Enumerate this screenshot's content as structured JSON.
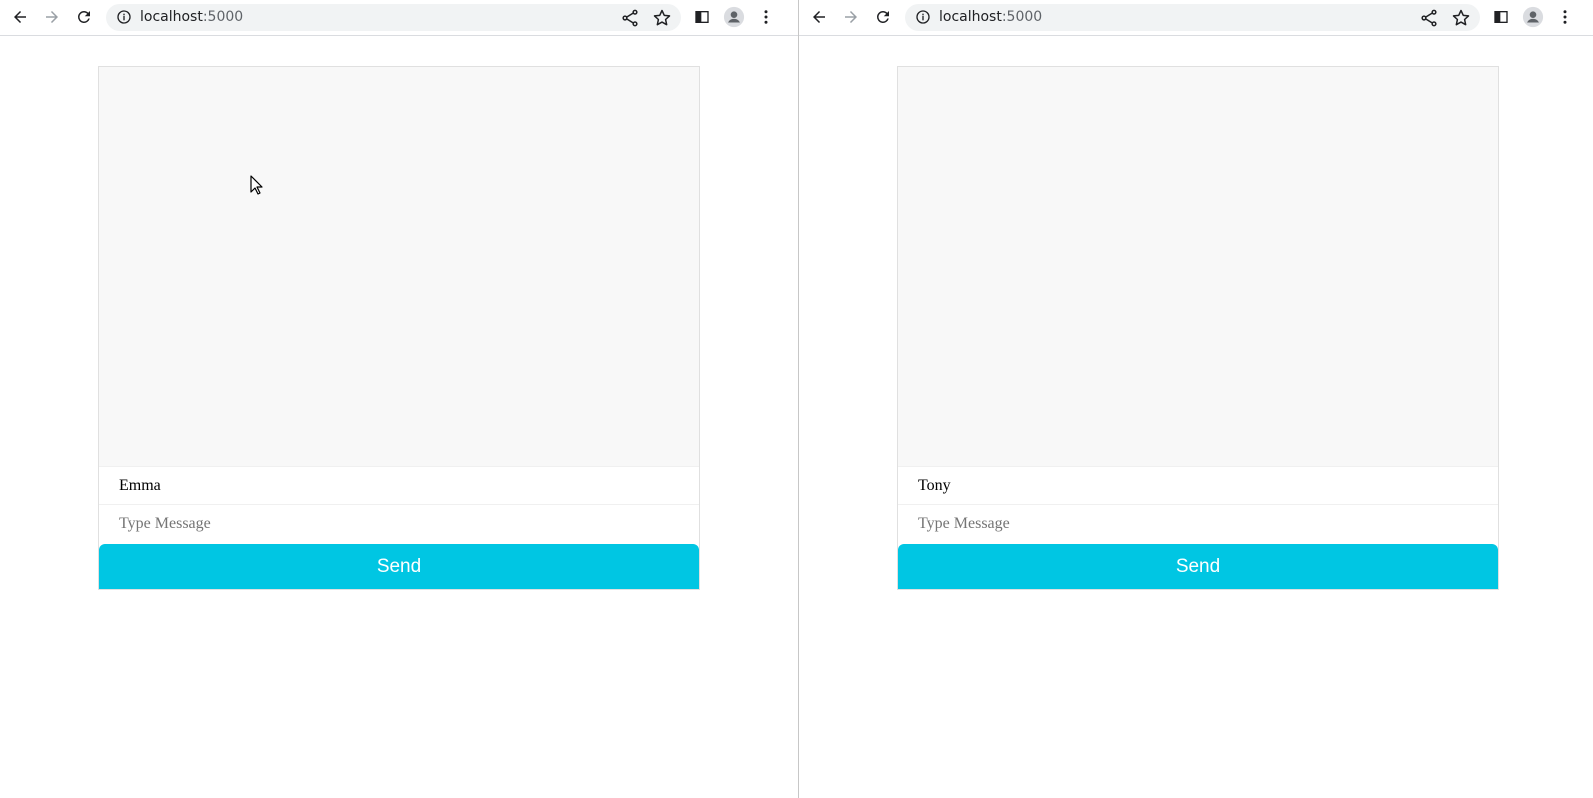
{
  "windows": [
    {
      "url_host": "localhost",
      "url_port": ":5000",
      "chat": {
        "name_value": "Emma",
        "message_placeholder": "Type Message",
        "send_label": "Send"
      }
    },
    {
      "url_host": "localhost",
      "url_port": ":5000",
      "chat": {
        "name_value": "Tony",
        "message_placeholder": "Type Message",
        "send_label": "Send"
      }
    }
  ],
  "icons": {
    "back": "back-arrow-icon",
    "forward": "forward-arrow-icon",
    "reload": "reload-icon",
    "info": "info-icon",
    "share": "share-icon",
    "star": "star-icon",
    "side_panel": "side-panel-icon",
    "profile": "profile-avatar-icon",
    "menu": "kebab-menu-icon"
  },
  "colors": {
    "send_button": "#00c6e3",
    "messages_bg": "#f8f8f8"
  }
}
